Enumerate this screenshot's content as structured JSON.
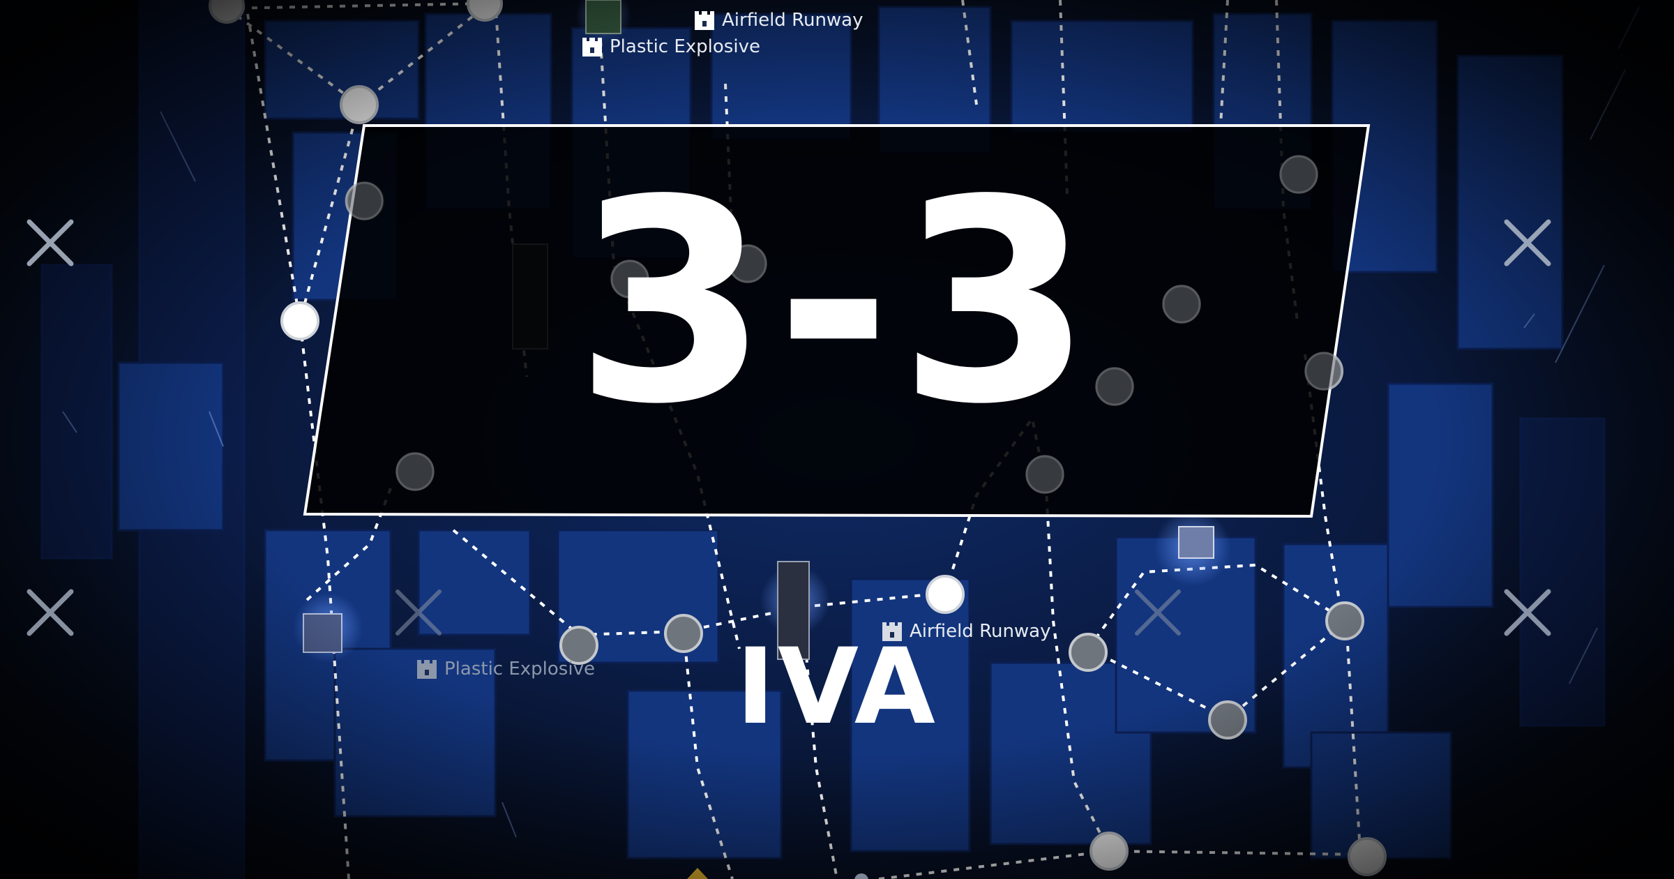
{
  "stage": {
    "number": "3-3",
    "name": "IVA"
  },
  "map": {
    "labels": [
      {
        "text": "Airfield Runway",
        "icon": "castle-icon",
        "dim": false
      },
      {
        "text": "Plastic Explosive",
        "icon": "castle-icon",
        "dim": false
      },
      {
        "text": "Airfield Runway",
        "icon": "castle-icon",
        "dim": false
      },
      {
        "text": "Plastic Explosive",
        "icon": "castle-icon",
        "dim": true
      }
    ],
    "close_icon": "close-x-icon"
  },
  "colors": {
    "background": "#0a1a40",
    "building": "#163a8c",
    "road": "#0a1226",
    "path": "#ffffff",
    "node_active": "#ffffff",
    "node_inactive": "#6f757d",
    "banner": "#000000",
    "banner_border": "#ffffff"
  }
}
